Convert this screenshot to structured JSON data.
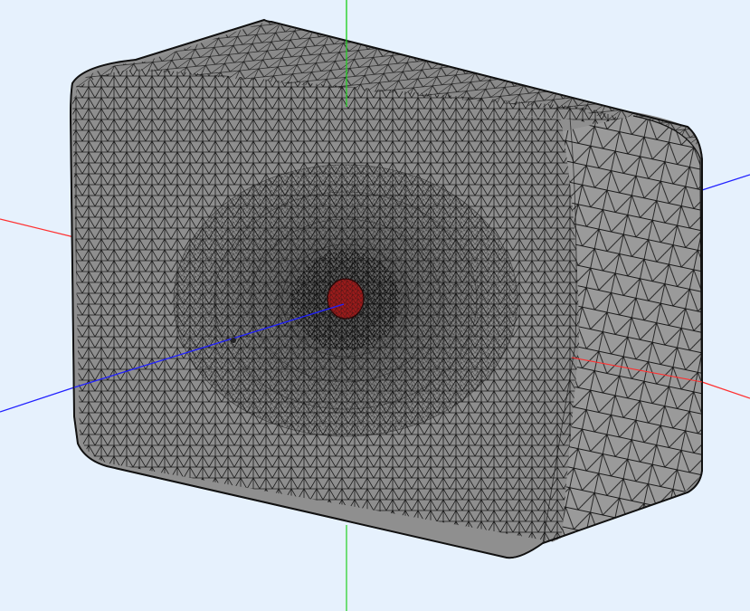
{
  "viewport": {
    "background": "#e6f1fd",
    "mesh_fill": "#8f8f8f",
    "mesh_shade_side": "#9a9a9a",
    "mesh_shade_top": "#8a8a8a",
    "mesh_edge_color": "#1a1a1a",
    "refinement_color": "#9b1b1b",
    "axes": [
      {
        "name": "x-axis",
        "color": "#ff3030"
      },
      {
        "name": "y-axis",
        "color": "#20d020"
      },
      {
        "name": "z-axis",
        "color": "#2020ff"
      }
    ],
    "icons": {
      "mesh": "tetrahedral-mesh-icon",
      "refinement": "refined-hole-icon"
    }
  }
}
